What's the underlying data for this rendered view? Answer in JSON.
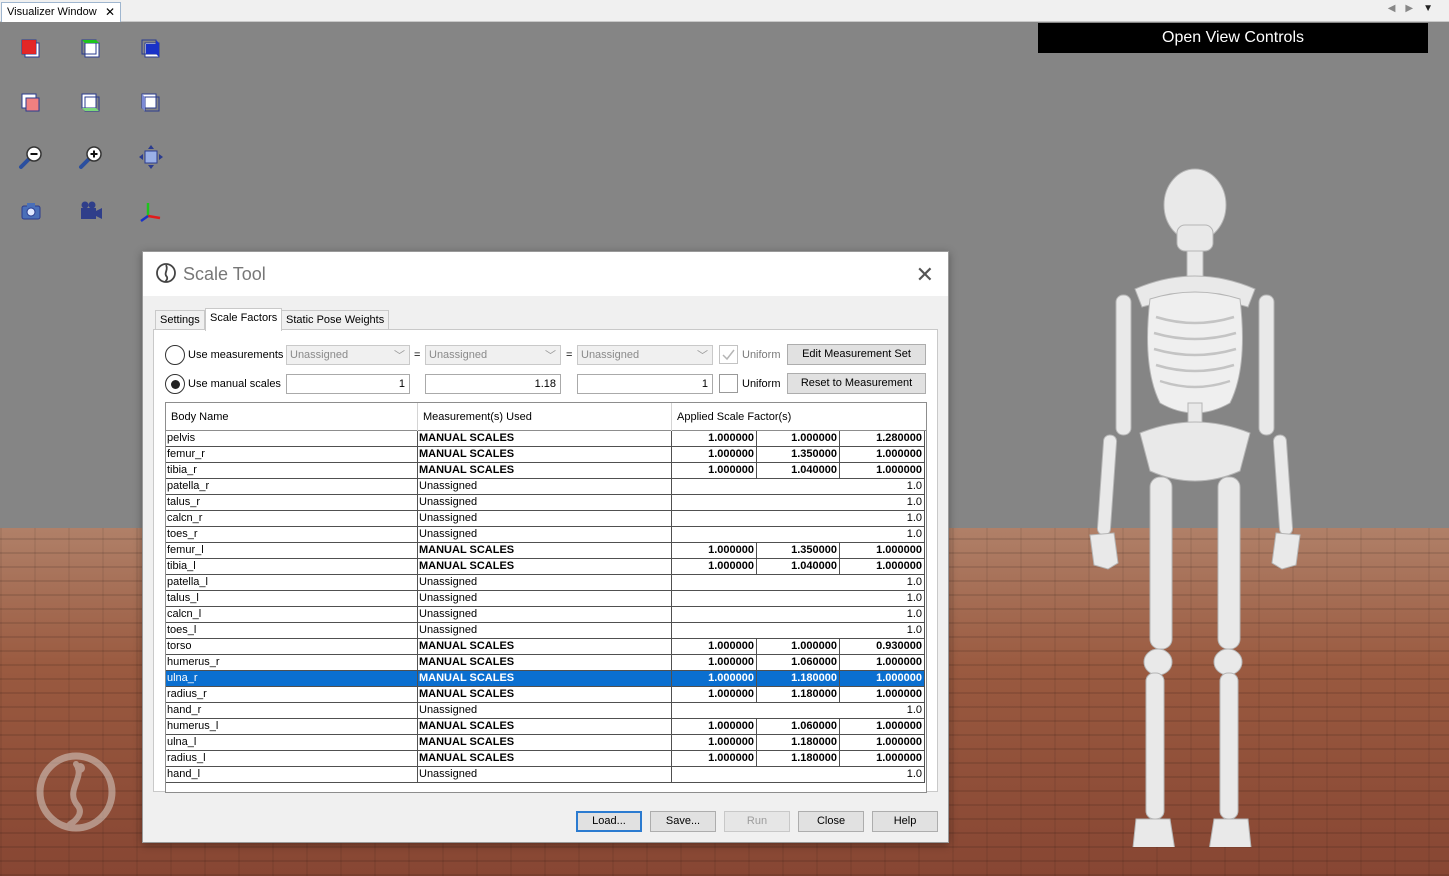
{
  "window_tab": {
    "title": "Visualizer Window",
    "close": "✕"
  },
  "viewport": {
    "open_view_controls": "Open View Controls"
  },
  "toolbar_icons": [
    "view-front-icon",
    "view-top-icon",
    "view-right-icon",
    "view-back-icon",
    "view-bottom-icon",
    "view-left-icon",
    "zoom-out-icon",
    "zoom-in-icon",
    "fit-view-icon",
    "snapshot-camera-icon",
    "record-video-icon",
    "axes-icon"
  ],
  "dialog": {
    "title": "Scale Tool",
    "tabs": [
      "Settings",
      "Scale Factors",
      "Static Pose Weights"
    ],
    "active_tab": 1,
    "use_measurements": {
      "label": "Use measurements",
      "combo1": "Unassigned",
      "combo2": "Unassigned",
      "combo3": "Unassigned",
      "eq": "=",
      "uniform_label": "Uniform",
      "button": "Edit Measurement Set"
    },
    "use_manual_scales": {
      "label": "Use manual scales",
      "x": "1",
      "y": "1.18",
      "z": "1",
      "uniform_label": "Uniform",
      "button": "Reset to Measurement"
    },
    "table": {
      "headers": [
        "Body Name",
        "Measurement(s) Used",
        "Applied Scale Factor(s)"
      ],
      "rows": [
        {
          "name": "pelvis",
          "meas": "MANUAL SCALES",
          "sf": [
            "1.000000",
            "1.000000",
            "1.280000"
          ]
        },
        {
          "name": "femur_r",
          "meas": "MANUAL SCALES",
          "sf": [
            "1.000000",
            "1.350000",
            "1.000000"
          ]
        },
        {
          "name": "tibia_r",
          "meas": "MANUAL SCALES",
          "sf": [
            "1.000000",
            "1.040000",
            "1.000000"
          ]
        },
        {
          "name": "patella_r",
          "meas": "Unassigned",
          "sf": [
            "1.0"
          ]
        },
        {
          "name": "talus_r",
          "meas": "Unassigned",
          "sf": [
            "1.0"
          ]
        },
        {
          "name": "calcn_r",
          "meas": "Unassigned",
          "sf": [
            "1.0"
          ]
        },
        {
          "name": "toes_r",
          "meas": "Unassigned",
          "sf": [
            "1.0"
          ]
        },
        {
          "name": "femur_l",
          "meas": "MANUAL SCALES",
          "sf": [
            "1.000000",
            "1.350000",
            "1.000000"
          ]
        },
        {
          "name": "tibia_l",
          "meas": "MANUAL SCALES",
          "sf": [
            "1.000000",
            "1.040000",
            "1.000000"
          ]
        },
        {
          "name": "patella_l",
          "meas": "Unassigned",
          "sf": [
            "1.0"
          ]
        },
        {
          "name": "talus_l",
          "meas": "Unassigned",
          "sf": [
            "1.0"
          ]
        },
        {
          "name": "calcn_l",
          "meas": "Unassigned",
          "sf": [
            "1.0"
          ]
        },
        {
          "name": "toes_l",
          "meas": "Unassigned",
          "sf": [
            "1.0"
          ]
        },
        {
          "name": "torso",
          "meas": "MANUAL SCALES",
          "sf": [
            "1.000000",
            "1.000000",
            "0.930000"
          ]
        },
        {
          "name": "humerus_r",
          "meas": "MANUAL SCALES",
          "sf": [
            "1.000000",
            "1.060000",
            "1.000000"
          ]
        },
        {
          "name": "ulna_r",
          "meas": "MANUAL SCALES",
          "sf": [
            "1.000000",
            "1.180000",
            "1.000000"
          ],
          "selected": true
        },
        {
          "name": "radius_r",
          "meas": "MANUAL SCALES",
          "sf": [
            "1.000000",
            "1.180000",
            "1.000000"
          ]
        },
        {
          "name": "hand_r",
          "meas": "Unassigned",
          "sf": [
            "1.0"
          ]
        },
        {
          "name": "humerus_l",
          "meas": "MANUAL SCALES",
          "sf": [
            "1.000000",
            "1.060000",
            "1.000000"
          ]
        },
        {
          "name": "ulna_l",
          "meas": "MANUAL SCALES",
          "sf": [
            "1.000000",
            "1.180000",
            "1.000000"
          ]
        },
        {
          "name": "radius_l",
          "meas": "MANUAL SCALES",
          "sf": [
            "1.000000",
            "1.180000",
            "1.000000"
          ]
        },
        {
          "name": "hand_l",
          "meas": "Unassigned",
          "sf": [
            "1.0"
          ]
        }
      ]
    },
    "buttons": {
      "load": "Load...",
      "save": "Save...",
      "run": "Run",
      "close": "Close",
      "help": "Help"
    }
  },
  "colors": {
    "selection": "#0a6fd0",
    "viewport_bg": "#858585",
    "floor": "#9a5a40"
  }
}
